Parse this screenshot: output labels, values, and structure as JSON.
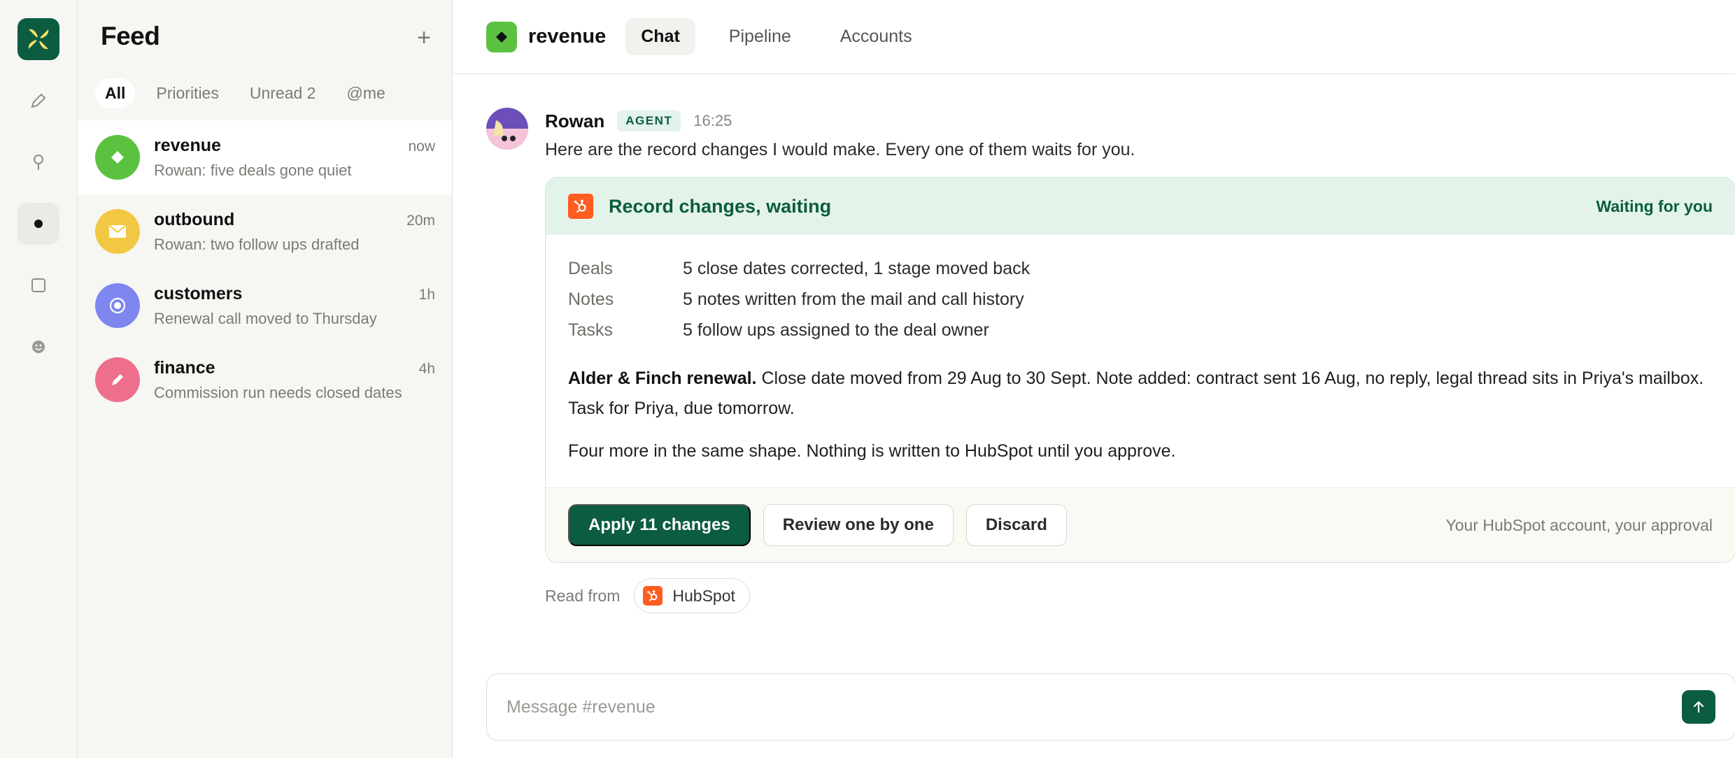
{
  "feed": {
    "title": "Feed",
    "add": "+",
    "filters": [
      {
        "label": "All"
      },
      {
        "label": "Priorities"
      },
      {
        "label": "Unread 2"
      },
      {
        "label": "@me"
      }
    ],
    "conversations": [
      {
        "name": "revenue",
        "time": "now",
        "preview": "Rowan: five deals gone quiet",
        "color": "#5bc240"
      },
      {
        "name": "outbound",
        "time": "20m",
        "preview": "Rowan: two follow ups drafted",
        "color": "#f2c744"
      },
      {
        "name": "customers",
        "time": "1h",
        "preview": "Renewal call moved to Thursday",
        "color": "#7f86f0"
      },
      {
        "name": "finance",
        "time": "4h",
        "preview": "Commission run needs closed dates",
        "color": "#ee6f8b"
      }
    ]
  },
  "channel": {
    "name": "revenue",
    "tabs": [
      {
        "label": "Chat"
      },
      {
        "label": "Pipeline"
      },
      {
        "label": "Accounts"
      }
    ]
  },
  "message": {
    "author": "Rowan",
    "badge": "AGENT",
    "time": "16:25",
    "text": "Here are the record changes I would make. Every one of them waits for you.",
    "card": {
      "title": "Record changes, waiting",
      "status": "Waiting for you",
      "summary": [
        {
          "key": "Deals",
          "value": "5 close dates corrected, 1 stage moved back"
        },
        {
          "key": "Notes",
          "value": "5 notes written from the mail and call history"
        },
        {
          "key": "Tasks",
          "value": "5 follow ups assigned to the deal owner"
        }
      ],
      "detail_lead": "Alder & Finch renewal.",
      "detail_text": " Close date moved from 29 Aug to 30 Sept. Note added: contract sent 16 Aug, no reply, legal thread sits in Priya's mailbox. Task for Priya, due tomorrow.",
      "detail2": "Four more in the same shape. Nothing is written to HubSpot until you approve.",
      "actions": {
        "apply": "Apply 11 changes",
        "review": "Review one by one",
        "discard": "Discard"
      },
      "footnote": "Your HubSpot account, your approval"
    },
    "source_label": "Read from",
    "source_name": "HubSpot"
  },
  "composer": {
    "placeholder": "Message #revenue"
  },
  "colors": {
    "brand": "#0b5c40",
    "hubspot": "#ff5c1f"
  }
}
